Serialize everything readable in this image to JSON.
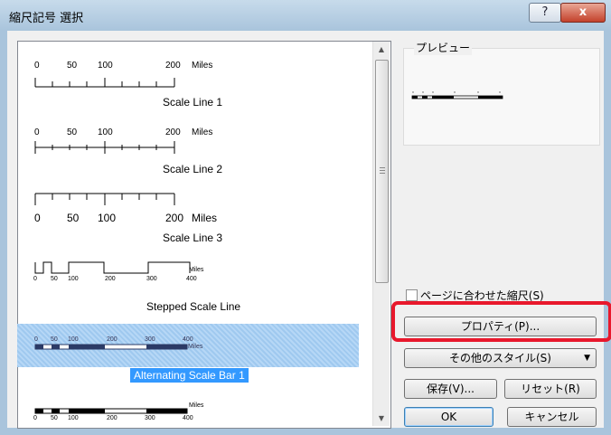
{
  "window": {
    "title": "縮尺記号 選択",
    "help_label": "?",
    "close_label": "x"
  },
  "list": {
    "items": [
      {
        "name": "Scale Line 1",
        "ticks": [
          "0",
          "50",
          "100",
          "200",
          "Miles"
        ]
      },
      {
        "name": "Scale Line 2",
        "ticks": [
          "0",
          "50",
          "100",
          "200",
          "Miles"
        ]
      },
      {
        "name": "Scale Line 3",
        "ticks": [
          "0",
          "50",
          "100",
          "200",
          "Miles"
        ]
      },
      {
        "name": "Stepped Scale Line",
        "ticks": [
          "0",
          "50",
          "100",
          "200",
          "300",
          "400",
          "Miles"
        ]
      },
      {
        "name": "Alternating Scale Bar 1",
        "ticks": [
          "0",
          "50",
          "100",
          "200",
          "300",
          "400",
          "Miles"
        ],
        "selected": true
      },
      {
        "name": "",
        "ticks": [
          "0",
          "50",
          "100",
          "200",
          "300",
          "400",
          "Miles"
        ]
      }
    ]
  },
  "preview": {
    "label": "プレビュー"
  },
  "options": {
    "fit_page_label": "ページに合わせた縮尺(S)",
    "fit_page_checked": false
  },
  "buttons": {
    "properties": "プロパティ(P)...",
    "more_styles": "その他のスタイル(S)",
    "save": "保存(V)...",
    "reset": "リセット(R)",
    "ok": "OK",
    "cancel": "キャンセル"
  },
  "colors": {
    "highlight": "#e8182c",
    "selection": "#3399ff",
    "title_bar": "#b9d1ea"
  }
}
